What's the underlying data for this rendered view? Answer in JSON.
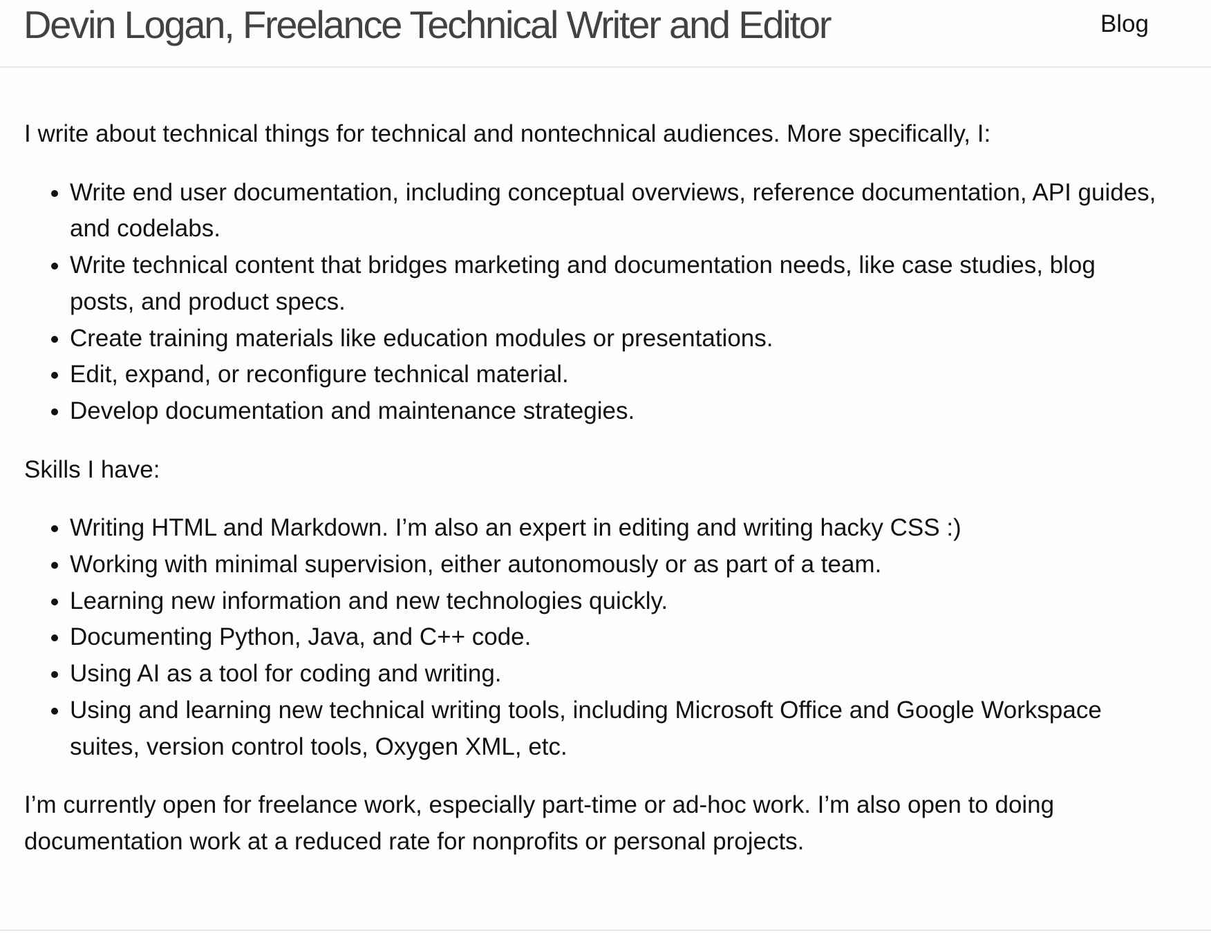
{
  "header": {
    "site_title": "Devin Logan, Freelance Technical Writer and Editor",
    "nav_blog": "Blog"
  },
  "main": {
    "intro": "I write about technical things for technical and nontechnical audiences. More specifically, I:",
    "services": [
      "Write end user documentation, including conceptual overviews, reference documentation, API guides, and codelabs.",
      "Write technical content that bridges marketing and documentation needs, like case studies, blog posts, and product specs.",
      "Create training materials like education modules or presentations.",
      "Edit, expand, or reconfigure technical material.",
      "Develop documentation and maintenance strategies."
    ],
    "skills_heading": "Skills I have:",
    "skills": [
      "Writing HTML and Markdown. I’m also an expert in editing and writing hacky CSS :)",
      "Working with minimal supervision, either autonomously or as part of a team.",
      "Learning new information and new technologies quickly.",
      "Documenting Python, Java, and C++ code.",
      "Using AI as a tool for coding and writing.",
      "Using and learning new technical writing tools, including Microsoft Office and Google Workspace suites, version control tools, Oxygen XML, etc."
    ],
    "closing": "I’m currently open for freelance work, especially part-time or ad-hoc work. I’m also open to doing documentation work at a reduced rate for nonprofits or personal projects."
  }
}
